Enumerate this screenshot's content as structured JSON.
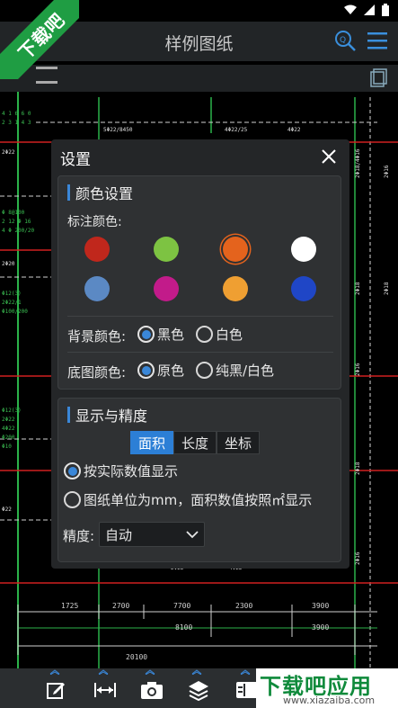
{
  "app": {
    "title": "样例图纸",
    "logo_text": "下载吧"
  },
  "dialog": {
    "title": "设置",
    "color_group": {
      "heading": "颜色设置",
      "annotation_label": "标注颜色:",
      "swatches": [
        "#c0271c",
        "#7dc342",
        "#e4631d",
        "#ffffff",
        "#5b89c4",
        "#c21b8a",
        "#ef9f32",
        "#1f46c6"
      ],
      "selected_swatch": 2,
      "background_label": "背景颜色:",
      "background_options": [
        "黑色",
        "白色"
      ],
      "background_selected": 0,
      "base_label": "底图颜色:",
      "base_options": [
        "原色",
        "纯黑/白色"
      ],
      "base_selected": 0
    },
    "display_group": {
      "heading": "显示与精度",
      "tabs": [
        "面积",
        "长度",
        "坐标"
      ],
      "active_tab": 0,
      "options": [
        "按实际数值显示",
        "图纸单位为mm，面积数值按照㎡显示"
      ],
      "selected_option": 0,
      "precision_label": "精度:",
      "precision_value": "自动"
    }
  },
  "brand": {
    "name": "下载吧应用",
    "url": "www.xiazaiba.com"
  },
  "toolbar": {
    "icons": [
      "edit-icon",
      "measure-icon",
      "camera-icon",
      "layers-icon",
      "panel-icon"
    ]
  },
  "colors": {
    "accent": "#2c7fd6",
    "dialog_bg": "#242628",
    "group_bg": "#2f3133",
    "logo_green": "#1f9d43"
  },
  "drawing": {
    "dimensions": [
      "1725",
      "2700",
      "7700",
      "2300",
      "3900",
      "8100",
      "3900",
      "20100"
    ],
    "labels": [
      "4@22/25",
      "4@22/25",
      "4@22/25",
      "2@22",
      "2@22",
      "4@22/25",
      "2@16",
      "2@22",
      "2@16"
    ]
  }
}
